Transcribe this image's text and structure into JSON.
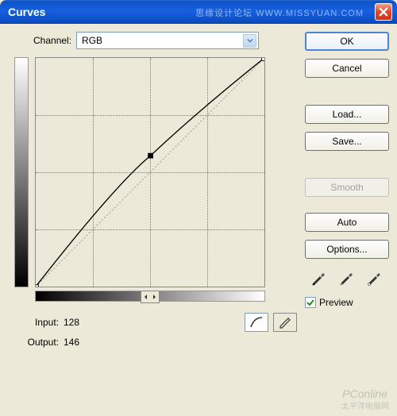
{
  "window": {
    "title": "Curves"
  },
  "channel": {
    "label": "Channel:",
    "value": "RGB"
  },
  "io": {
    "input_label": "Input:",
    "input_value": "128",
    "output_label": "Output:",
    "output_value": "146"
  },
  "buttons": {
    "ok": "OK",
    "cancel": "Cancel",
    "load": "Load...",
    "save": "Save...",
    "smooth": "Smooth",
    "auto": "Auto",
    "options": "Options..."
  },
  "preview": {
    "label": "Preview",
    "checked": true
  },
  "chart_data": {
    "type": "line",
    "xlabel": "Input",
    "ylabel": "Output",
    "xlim": [
      0,
      255
    ],
    "ylim": [
      0,
      255
    ],
    "grid": true,
    "points": [
      {
        "x": 0,
        "y": 0
      },
      {
        "x": 128,
        "y": 146
      },
      {
        "x": 255,
        "y": 255
      }
    ],
    "selected_point": {
      "x": 128,
      "y": 146
    }
  },
  "icons": {
    "close": "close-icon",
    "dropdown": "chevron-down-icon",
    "curve_mode": "curve-icon",
    "pencil_mode": "pencil-icon",
    "eyedropper_black": "eyedropper-black-icon",
    "eyedropper_gray": "eyedropper-gray-icon",
    "eyedropper_white": "eyedropper-white-icon",
    "slider": "slider-handles-icon",
    "check": "check-icon"
  },
  "watermarks": {
    "top": "思缘设计论坛  WWW.MISSYUAN.COM",
    "pconline": "PConline",
    "bottom": "太平洋电脑网"
  }
}
